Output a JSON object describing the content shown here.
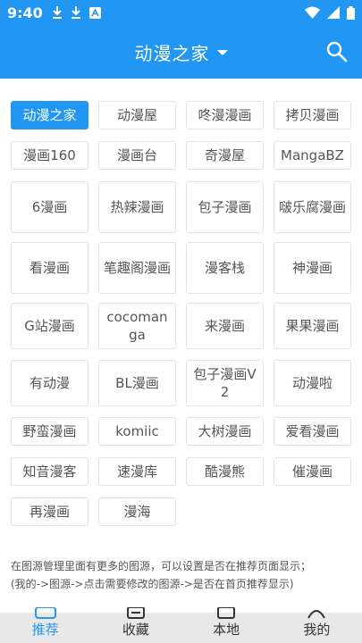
{
  "status_bar": {
    "time": "9:40",
    "icons_left": [
      "download-icon",
      "download-icon",
      "app-notification-icon"
    ],
    "icons_right": [
      "wifi-icon",
      "cellular-icon",
      "battery-icon"
    ]
  },
  "app_bar": {
    "title": "动漫之家",
    "search_icon": "search-icon",
    "color": "#2196f3"
  },
  "sources": [
    {
      "label": "动漫之家",
      "selected": true
    },
    {
      "label": "动漫屋"
    },
    {
      "label": "咚漫漫画"
    },
    {
      "label": "拷贝漫画"
    },
    {
      "label": "漫画160"
    },
    {
      "label": "漫画台"
    },
    {
      "label": "奇漫屋"
    },
    {
      "label": "MangaBZ"
    },
    {
      "label": "6漫画"
    },
    {
      "label": "热辣漫画"
    },
    {
      "label": "包子漫画"
    },
    {
      "label": "啵乐腐漫画"
    },
    {
      "label": "看漫画"
    },
    {
      "label": "笔趣阁漫画"
    },
    {
      "label": "漫客栈"
    },
    {
      "label": "神漫画"
    },
    {
      "label": "G站漫画"
    },
    {
      "label": "cocomanga"
    },
    {
      "label": "来漫画"
    },
    {
      "label": "果果漫画"
    },
    {
      "label": "有动漫"
    },
    {
      "label": "BL漫画"
    },
    {
      "label": "包子漫画V2"
    },
    {
      "label": "动漫啦"
    },
    {
      "label": "野蛮漫画"
    },
    {
      "label": "komiic"
    },
    {
      "label": "大树漫画"
    },
    {
      "label": "爱看漫画"
    },
    {
      "label": "知音漫客"
    },
    {
      "label": "速漫库"
    },
    {
      "label": "酷漫熊"
    },
    {
      "label": "催漫画"
    },
    {
      "label": "再漫画"
    },
    {
      "label": "漫海"
    }
  ],
  "note": {
    "line1": "在图源管理里面有更多的图源，可以设置是否在推荐页面显示；",
    "line2": "(我的->图源->点击需要修改的图源->是否在首页推荐显示)"
  },
  "bottom_nav": [
    {
      "label": "推荐",
      "icon": "recommend-icon",
      "active": true
    },
    {
      "label": "收藏",
      "icon": "bookshelf-icon"
    },
    {
      "label": "本地",
      "icon": "local-icon"
    },
    {
      "label": "我的",
      "icon": "profile-icon"
    }
  ]
}
